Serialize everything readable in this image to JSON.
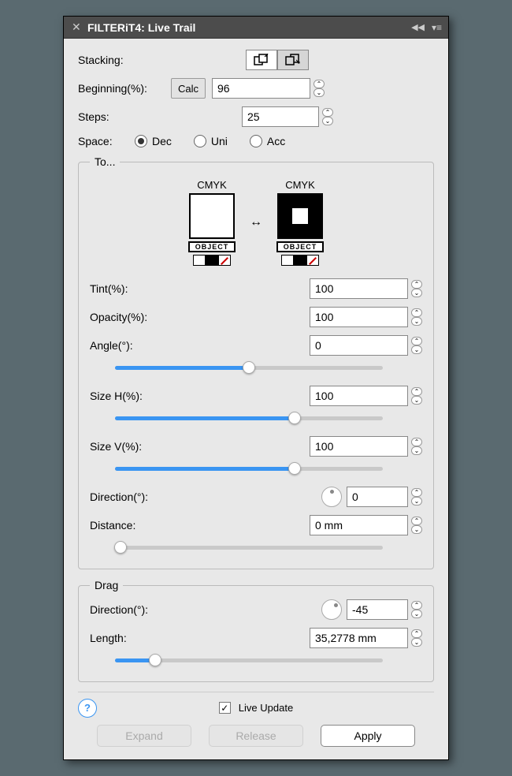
{
  "window": {
    "title": "FILTERiT4: Live Trail"
  },
  "top": {
    "stacking_label": "Stacking:",
    "beginning_label": "Beginning(%):",
    "calc_label": "Calc",
    "beginning_value": "96",
    "steps_label": "Steps:",
    "steps_value": "25",
    "space_label": "Space:",
    "space_options": {
      "dec": "Dec",
      "uni": "Uni",
      "acc": "Acc"
    },
    "space_selected": "dec"
  },
  "to": {
    "legend": "To...",
    "cmyk_label": "CMYK",
    "object_tag": "OBJECT",
    "tint_label": "Tint(%):",
    "tint_value": "100",
    "opacity_label": "Opacity(%):",
    "opacity_value": "100",
    "angle_label": "Angle(°):",
    "angle_value": "0",
    "angle_slider_pct": 50,
    "sizeh_label": "Size H(%):",
    "sizeh_value": "100",
    "sizeh_slider_pct": 67,
    "sizev_label": "Size V(%):",
    "sizev_value": "100",
    "sizev_slider_pct": 67,
    "direction_label": "Direction(°):",
    "direction_value": "0",
    "distance_label": "Distance:",
    "distance_value": "0 mm",
    "distance_slider_pct": 2
  },
  "drag": {
    "legend": "Drag",
    "direction_label": "Direction(°):",
    "direction_value": "-45",
    "length_label": "Length:",
    "length_value": "35,2778 mm",
    "length_slider_pct": 15
  },
  "footer": {
    "live_update_label": "Live Update",
    "live_update_checked": true,
    "expand": "Expand",
    "release": "Release",
    "apply": "Apply"
  }
}
